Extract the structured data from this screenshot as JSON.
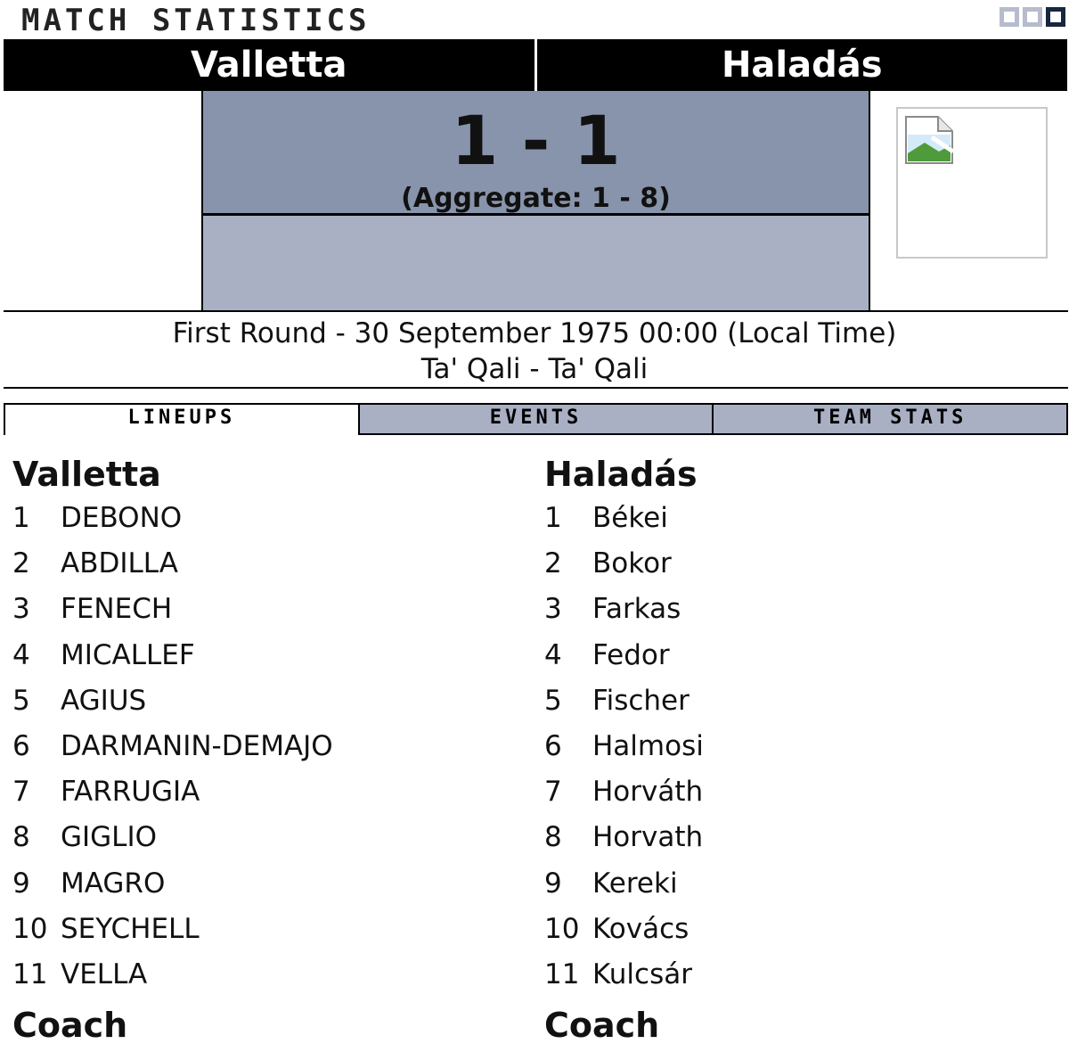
{
  "title": "MATCH STATISTICS",
  "teams": {
    "home": "Valletta",
    "away": "Haladás"
  },
  "score": {
    "main": "1 - 1",
    "aggregate": "(Aggregate: 1 - 8)"
  },
  "match_info": {
    "line1": "First Round - 30 September 1975 00:00 (Local Time)",
    "line2": "Ta' Qali - Ta' Qali"
  },
  "tabs": [
    {
      "label": "LINEUPS",
      "active": true
    },
    {
      "label": "EVENTS",
      "active": false
    },
    {
      "label": "TEAM STATS",
      "active": false
    }
  ],
  "lineups": {
    "home": {
      "name": "Valletta",
      "players": [
        {
          "num": "1",
          "name": "DEBONO"
        },
        {
          "num": "2",
          "name": "ABDILLA"
        },
        {
          "num": "3",
          "name": "FENECH"
        },
        {
          "num": "4",
          "name": "MICALLEF"
        },
        {
          "num": "5",
          "name": "AGIUS"
        },
        {
          "num": "6",
          "name": "DARMANIN-DEMAJO"
        },
        {
          "num": "7",
          "name": "FARRUGIA"
        },
        {
          "num": "8",
          "name": "GIGLIO"
        },
        {
          "num": "9",
          "name": "MAGRO"
        },
        {
          "num": "10",
          "name": "SEYCHELL"
        },
        {
          "num": "11",
          "name": "VELLA"
        }
      ],
      "coach_label": "Coach"
    },
    "away": {
      "name": "Haladás",
      "players": [
        {
          "num": "1",
          "name": "Békei"
        },
        {
          "num": "2",
          "name": "Bokor"
        },
        {
          "num": "3",
          "name": "Farkas"
        },
        {
          "num": "4",
          "name": "Fedor"
        },
        {
          "num": "5",
          "name": "Fischer"
        },
        {
          "num": "6",
          "name": "Halmosi"
        },
        {
          "num": "7",
          "name": "Horváth"
        },
        {
          "num": "8",
          "name": "Horvath"
        },
        {
          "num": "9",
          "name": "Kereki"
        },
        {
          "num": "10",
          "name": "Kovács"
        },
        {
          "num": "11",
          "name": "Kulcsár"
        }
      ],
      "coach_label": "Coach"
    }
  },
  "icons": {
    "window_controls": [
      "window-control-icon",
      "window-control-icon",
      "window-control-icon"
    ],
    "image": "broken-image-icon"
  },
  "colors": {
    "header_bg": "#000000",
    "score_bg": "#8894ab",
    "score_lower_bg": "#aab0c4",
    "tab_inactive_bg": "#aab0c4",
    "window_control_active": "#18263f",
    "window_control_inactive": "#b6bccc"
  }
}
